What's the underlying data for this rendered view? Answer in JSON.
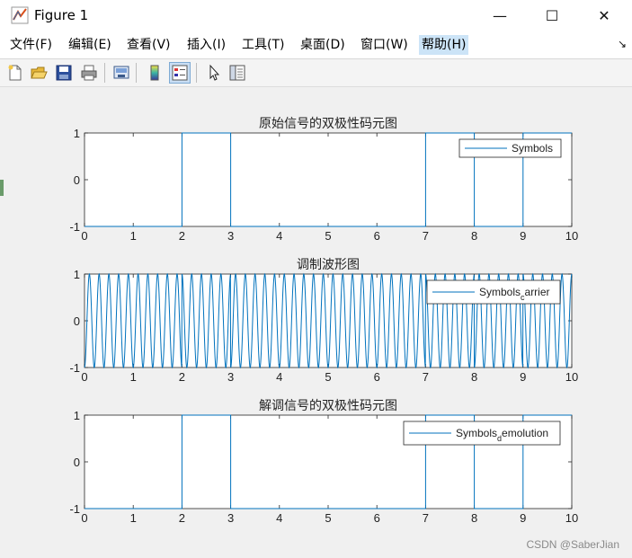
{
  "window": {
    "title": "Figure 1"
  },
  "titlebar_buttons": {
    "minimize": "—",
    "maximize": "☐",
    "close": "✕"
  },
  "menu": [
    {
      "label": "文件(F)"
    },
    {
      "label": "编辑(E)"
    },
    {
      "label": "查看(V)"
    },
    {
      "label": "插入(I)"
    },
    {
      "label": "工具(T)"
    },
    {
      "label": "桌面(D)"
    },
    {
      "label": "窗口(W)"
    },
    {
      "label": "帮助(H)"
    }
  ],
  "toolbar_icons": [
    "new-figure-icon",
    "open-file-icon",
    "save-icon",
    "print-icon",
    "link-plot-icon",
    "colorbar-icon",
    "legend-icon",
    "select-arrow-icon",
    "property-inspector-icon"
  ],
  "watermark": "CSDN @SaberJian",
  "colors": {
    "line": "#0072bd",
    "axes_bg": "#ffffff",
    "figure_bg": "#f0f0f0"
  },
  "chart_data": [
    {
      "type": "line",
      "title": "原始信号的双极性码元图",
      "xlim": [
        0,
        10
      ],
      "ylim": [
        -1,
        1
      ],
      "xticks": [
        "0",
        "1",
        "2",
        "3",
        "4",
        "5",
        "6",
        "7",
        "8",
        "9",
        "10"
      ],
      "yticks": [
        "1",
        "0",
        "-1"
      ],
      "legend": "Symbols",
      "legend_sub": "",
      "legend_rest": "",
      "legend_placement": "top-right",
      "symbols": [
        -1,
        -1,
        1,
        -1,
        -1,
        -1,
        -1,
        1,
        -1,
        1
      ]
    },
    {
      "type": "line",
      "title": "调制波形图",
      "xlim": [
        0,
        10
      ],
      "ylim": [
        -1,
        1
      ],
      "xticks": [
        "0",
        "1",
        "2",
        "3",
        "4",
        "5",
        "6",
        "7",
        "8",
        "9",
        "10"
      ],
      "yticks": [
        "1",
        "0",
        "-1"
      ],
      "legend": "Symbols",
      "legend_sub": "c",
      "legend_rest": "arrier",
      "legend_placement": "top-right",
      "carrier_cycles_per_unit": 5,
      "symbols": [
        -1,
        -1,
        1,
        -1,
        -1,
        -1,
        -1,
        1,
        -1,
        1
      ]
    },
    {
      "type": "line",
      "title": "解调信号的双极性码元图",
      "xlim": [
        0,
        10
      ],
      "ylim": [
        -1,
        1
      ],
      "xticks": [
        "0",
        "1",
        "2",
        "3",
        "4",
        "5",
        "6",
        "7",
        "8",
        "9",
        "10"
      ],
      "yticks": [
        "1",
        "0",
        "-1"
      ],
      "legend": "Symbols",
      "legend_sub": "d",
      "legend_rest": "emolution",
      "legend_placement": "top-right",
      "symbols": [
        -1,
        -1,
        1,
        -1,
        -1,
        -1,
        -1,
        1,
        -1,
        1
      ]
    }
  ]
}
